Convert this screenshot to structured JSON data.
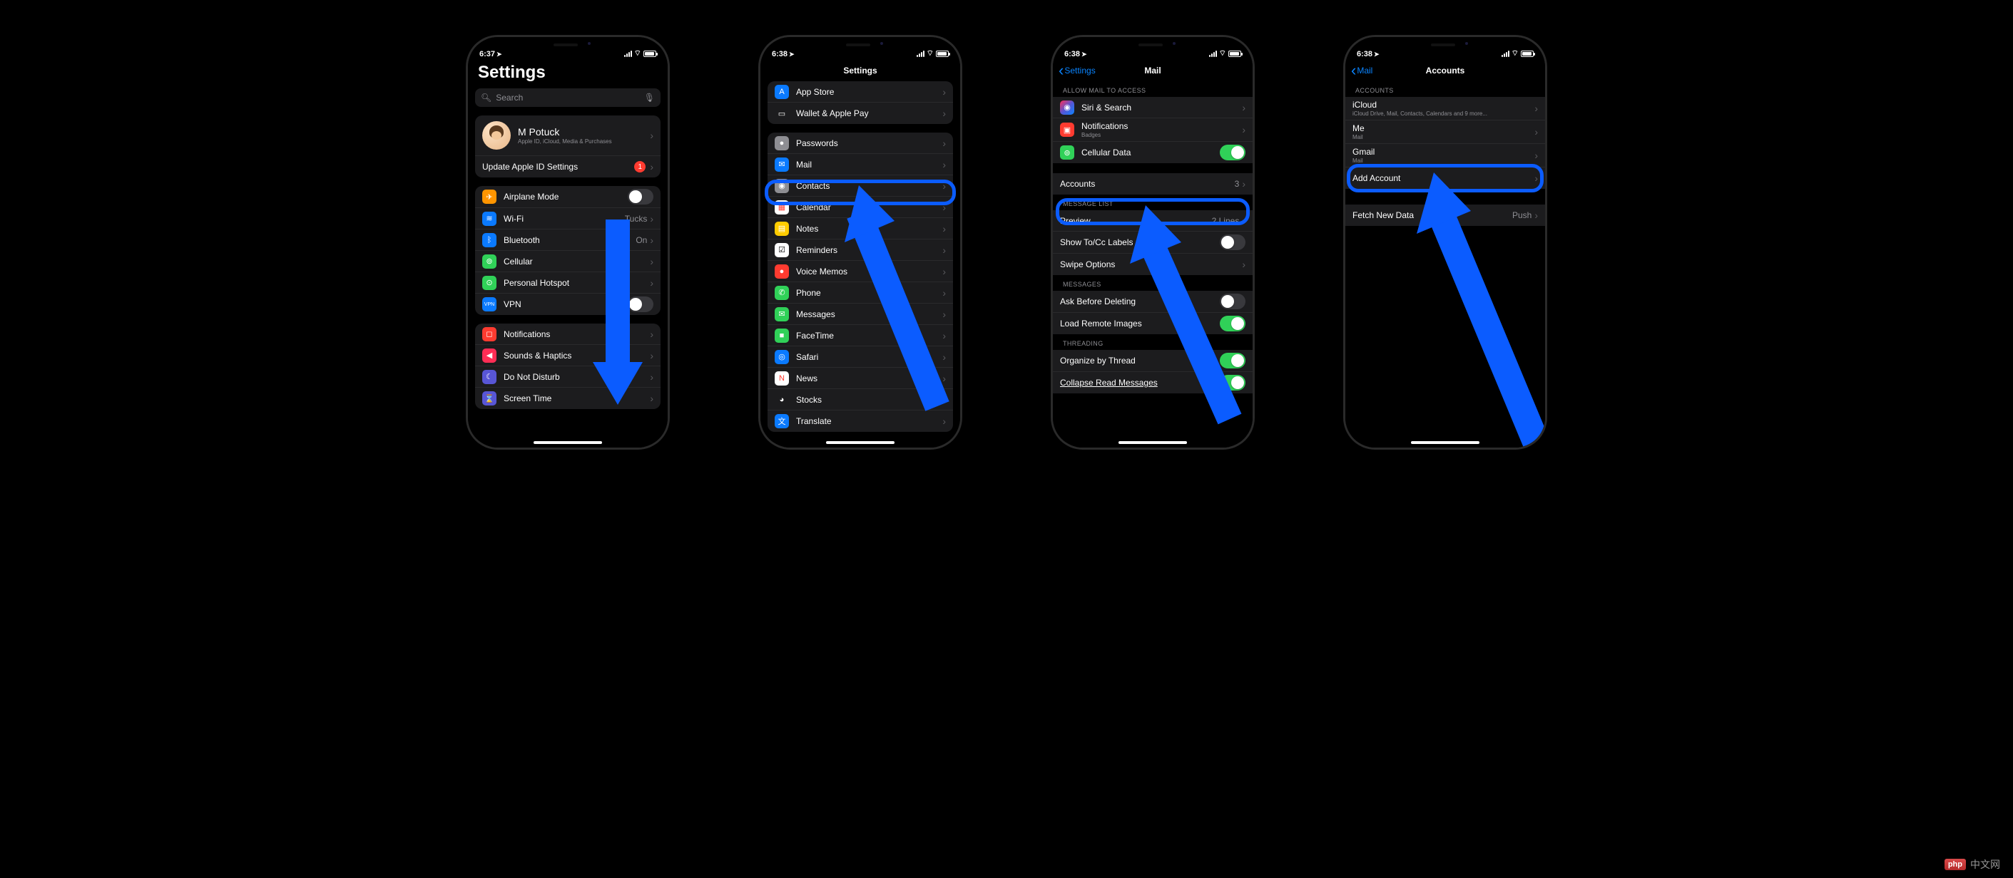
{
  "status": {
    "times": [
      "6:37",
      "6:38",
      "6:38",
      "6:38"
    ],
    "location_arrow": "➤"
  },
  "phone1": {
    "title": "Settings",
    "search_placeholder": "Search",
    "profile": {
      "name": "M Potuck",
      "sub": "Apple ID, iCloud, Media & Purchases"
    },
    "update_row": {
      "label": "Update Apple ID Settings",
      "badge": "1"
    },
    "group_network": [
      {
        "icon": "✈",
        "bg": "#ff9500",
        "label": "Airplane Mode",
        "toggle": false
      },
      {
        "icon": "≋",
        "bg": "#0a7aff",
        "label": "Wi-Fi",
        "value": "Tucks"
      },
      {
        "icon": "ᛒ",
        "bg": "#0a7aff",
        "label": "Bluetooth",
        "value": "On"
      },
      {
        "icon": "⊚",
        "bg": "#30d158",
        "label": "Cellular"
      },
      {
        "icon": "⊙",
        "bg": "#30d158",
        "label": "Personal Hotspot"
      },
      {
        "icon": "VPN",
        "bg": "#0a7aff",
        "label": "VPN",
        "toggle": false,
        "small": true
      }
    ],
    "group_general": [
      {
        "icon": "◻",
        "bg": "#ff3b30",
        "label": "Notifications"
      },
      {
        "icon": "◀",
        "bg": "#ff2d55",
        "label": "Sounds & Haptics"
      },
      {
        "icon": "☾",
        "bg": "#5856d6",
        "label": "Do Not Disturb"
      },
      {
        "icon": "⌛",
        "bg": "#5856d6",
        "label": "Screen Time"
      }
    ]
  },
  "phone2": {
    "title": "Settings",
    "items": [
      {
        "icon": "A",
        "bg": "#0a7aff",
        "label": "App Store"
      },
      {
        "icon": "▭",
        "bg": "#1c1c1e",
        "label": "Wallet & Apple Pay"
      },
      {
        "spacer": true
      },
      {
        "icon": "●",
        "bg": "#8e8e93",
        "label": "Passwords"
      },
      {
        "icon": "✉",
        "bg": "#0a7aff",
        "label": "Mail",
        "highlight": true
      },
      {
        "icon": "◉",
        "bg": "#8e8e93",
        "label": "Contacts"
      },
      {
        "icon": "▦",
        "bg": "#ffffff",
        "fg": "#ff3b30",
        "label": "Calendar"
      },
      {
        "icon": "▤",
        "bg": "#ffcc00",
        "label": "Notes"
      },
      {
        "icon": "☑",
        "bg": "#ffffff",
        "fg": "#000",
        "label": "Reminders"
      },
      {
        "icon": "●",
        "bg": "#ff3b30",
        "label": "Voice Memos"
      },
      {
        "icon": "✆",
        "bg": "#30d158",
        "label": "Phone"
      },
      {
        "icon": "✉",
        "bg": "#30d158",
        "label": "Messages"
      },
      {
        "icon": "■",
        "bg": "#30d158",
        "label": "FaceTime"
      },
      {
        "icon": "◎",
        "bg": "#0a7aff",
        "label": "Safari"
      },
      {
        "icon": "N",
        "bg": "#ffffff",
        "fg": "#ff3b30",
        "label": "News"
      },
      {
        "icon": "◕",
        "bg": "#1c1c1e",
        "label": "Stocks"
      },
      {
        "icon": "文",
        "bg": "#0a7aff",
        "label": "Translate"
      }
    ]
  },
  "phone3": {
    "back": "Settings",
    "title": "Mail",
    "section_access": "ALLOW MAIL TO ACCESS",
    "access_items": [
      {
        "icon": "◉",
        "bg": "linear-gradient(135deg,#ff2d55,#5856d6,#0a84ff)",
        "label": "Siri & Search"
      },
      {
        "icon": "▣",
        "bg": "#ff3b30",
        "label": "Notifications",
        "sub": "Badges"
      },
      {
        "icon": "⊚",
        "bg": "#30d158",
        "label": "Cellular Data",
        "toggle": true
      }
    ],
    "accounts": {
      "label": "Accounts",
      "value": "3",
      "highlight": true
    },
    "section_list": "MESSAGE LIST",
    "list_items": [
      {
        "label": "Preview",
        "value": "2 Lines"
      },
      {
        "label": "Show To/Cc Labels",
        "toggle": false
      },
      {
        "label": "Swipe Options"
      }
    ],
    "section_messages": "MESSAGES",
    "msg_items": [
      {
        "label": "Ask Before Deleting",
        "toggle": false
      },
      {
        "label": "Load Remote Images",
        "toggle": true
      }
    ],
    "section_threading": "THREADING",
    "thread_items": [
      {
        "label": "Organize by Thread",
        "toggle": true
      },
      {
        "label": "Collapse Read Messages",
        "toggle": true,
        "underline": true
      }
    ]
  },
  "phone4": {
    "back": "Mail",
    "title": "Accounts",
    "section_accounts": "ACCOUNTS",
    "accounts": [
      {
        "label": "iCloud",
        "sub": "iCloud Drive, Mail, Contacts, Calendars and 9 more..."
      },
      {
        "label": "Me",
        "sub": "Mail"
      },
      {
        "label": "Gmail",
        "sub": "Mail",
        "highlight": true
      },
      {
        "label": "Add Account"
      }
    ],
    "fetch": {
      "label": "Fetch New Data",
      "value": "Push"
    }
  },
  "watermark": {
    "badge": "php",
    "text": "中文网"
  }
}
